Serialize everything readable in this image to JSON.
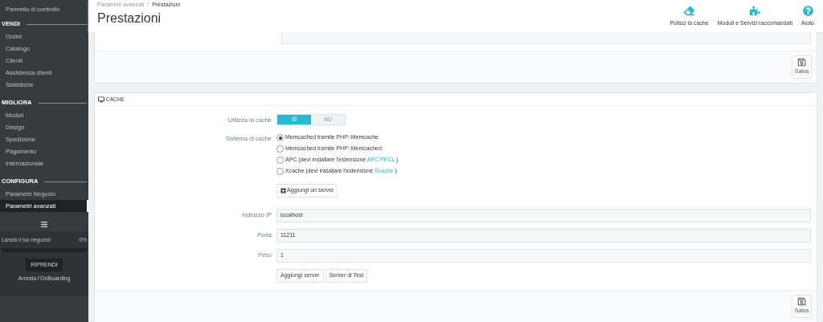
{
  "sidebar": {
    "top_item": {
      "label": "Pannello di controllo",
      "selected": false
    },
    "sections": [
      {
        "title": "VENDI",
        "items": [
          {
            "label": "Ordini",
            "selected": false
          },
          {
            "label": "Catalogo",
            "selected": false
          },
          {
            "label": "Clienti",
            "selected": false
          },
          {
            "label": "Assistenza clienti",
            "selected": false
          },
          {
            "label": "Statistiche",
            "selected": false
          }
        ]
      },
      {
        "title": "MIGLIORA",
        "items": [
          {
            "label": "Moduli",
            "selected": false
          },
          {
            "label": "Design",
            "selected": false
          },
          {
            "label": "Spedizione",
            "selected": false
          },
          {
            "label": "Pagamento",
            "selected": false
          },
          {
            "label": "Internazionale",
            "selected": false
          }
        ]
      },
      {
        "title": "CONFIGURA",
        "items": [
          {
            "label": "Parametri Negozio",
            "selected": false
          },
          {
            "label": "Parametri avanzati",
            "selected": true
          }
        ]
      }
    ],
    "onboarding": {
      "text": "Lancia il tuo negozio!",
      "percent": "0%",
      "level": 0,
      "button": "RIPRENDI",
      "link": "Arresta l'OnBoarding"
    }
  },
  "header": {
    "breadcrumb": [
      "Parametri avanzati",
      "Prestazioni"
    ],
    "breadcrumb_separator": "/",
    "title": "Prestazioni",
    "toolbar": [
      {
        "kind": "eraser",
        "label": "Pulisci la cache"
      },
      {
        "kind": "puzzle",
        "label": "Moduli e Servizi raccomandati"
      },
      {
        "kind": "help",
        "label": "Aiuto"
      }
    ]
  },
  "server_panel": {
    "save": "Salva"
  },
  "cache_panel": {
    "title": "CACHE",
    "use_cache": {
      "label": "Utilizza la cache",
      "options": [
        {
          "label": "SÌ",
          "selected": true
        },
        {
          "label": "NO",
          "selected": false
        }
      ]
    },
    "cache_system": {
      "label": "Sistema di cache",
      "options": [
        {
          "text": "Memcached tramite PHP::Memcache",
          "selected": true
        },
        {
          "text": "Memcached tramite PHP::Memcached",
          "selected": false
        },
        {
          "text": "APC (devi installare l'estensione",
          "link": "APC PECL",
          "after": ")",
          "selected": false
        },
        {
          "text": "Xcache (devi installare l'estensione",
          "link": "Xcache",
          "after": ")",
          "selected": false
        }
      ]
    },
    "add_server": "Aggiungi un server",
    "fields": [
      {
        "label": "Indirizzo IP",
        "value": "localhost"
      },
      {
        "label": "Porta",
        "value": "11211"
      },
      {
        "label": "Peso",
        "value": "1"
      }
    ],
    "buttons": [
      "Aggiungi server",
      "Server di Test"
    ],
    "save": "Salva"
  }
}
